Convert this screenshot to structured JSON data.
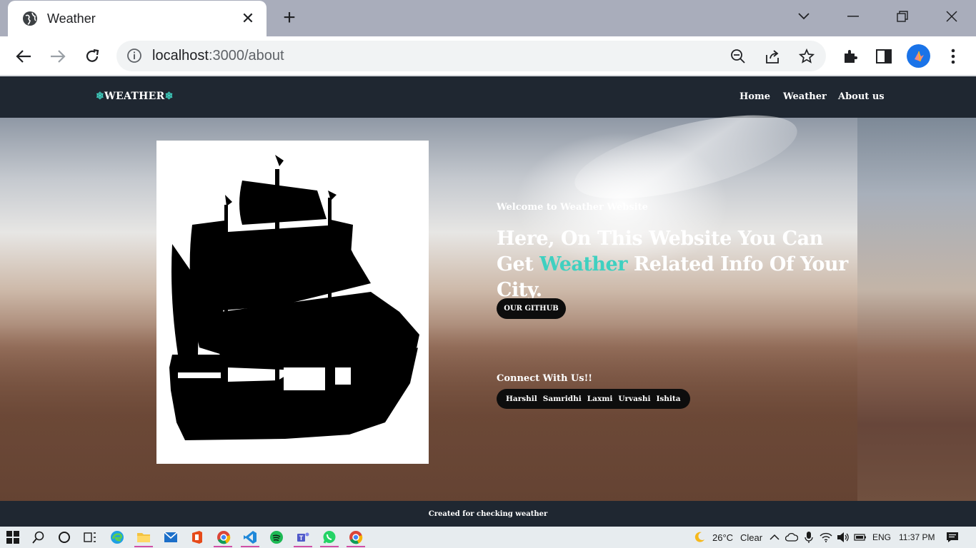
{
  "browser": {
    "tab_title": "Weather",
    "url_host": "localhost",
    "url_path": ":3000/about"
  },
  "site": {
    "brand": "WEATHER",
    "nav": [
      "Home",
      "Weather",
      "About us"
    ],
    "welcome": "Welcome to Weather Website",
    "headline_part1": "Here, On This Website You Can Get",
    "headline_accent": "Weather",
    "headline_part2": "Related Info Of Your City.",
    "github_button": "OUR GITHUB",
    "connect_heading": "Connect With Us!!",
    "members": [
      "Harshil",
      "Samridhi",
      "Laxmi",
      "Urvashi",
      "Ishita"
    ],
    "footer": "Created for checking weather",
    "accent_color": "#3fd0c0",
    "nav_bg": "#1f2731"
  },
  "taskbar": {
    "temperature": "26°C",
    "condition": "Clear",
    "language": "ENG",
    "time": "11:37 PM"
  }
}
